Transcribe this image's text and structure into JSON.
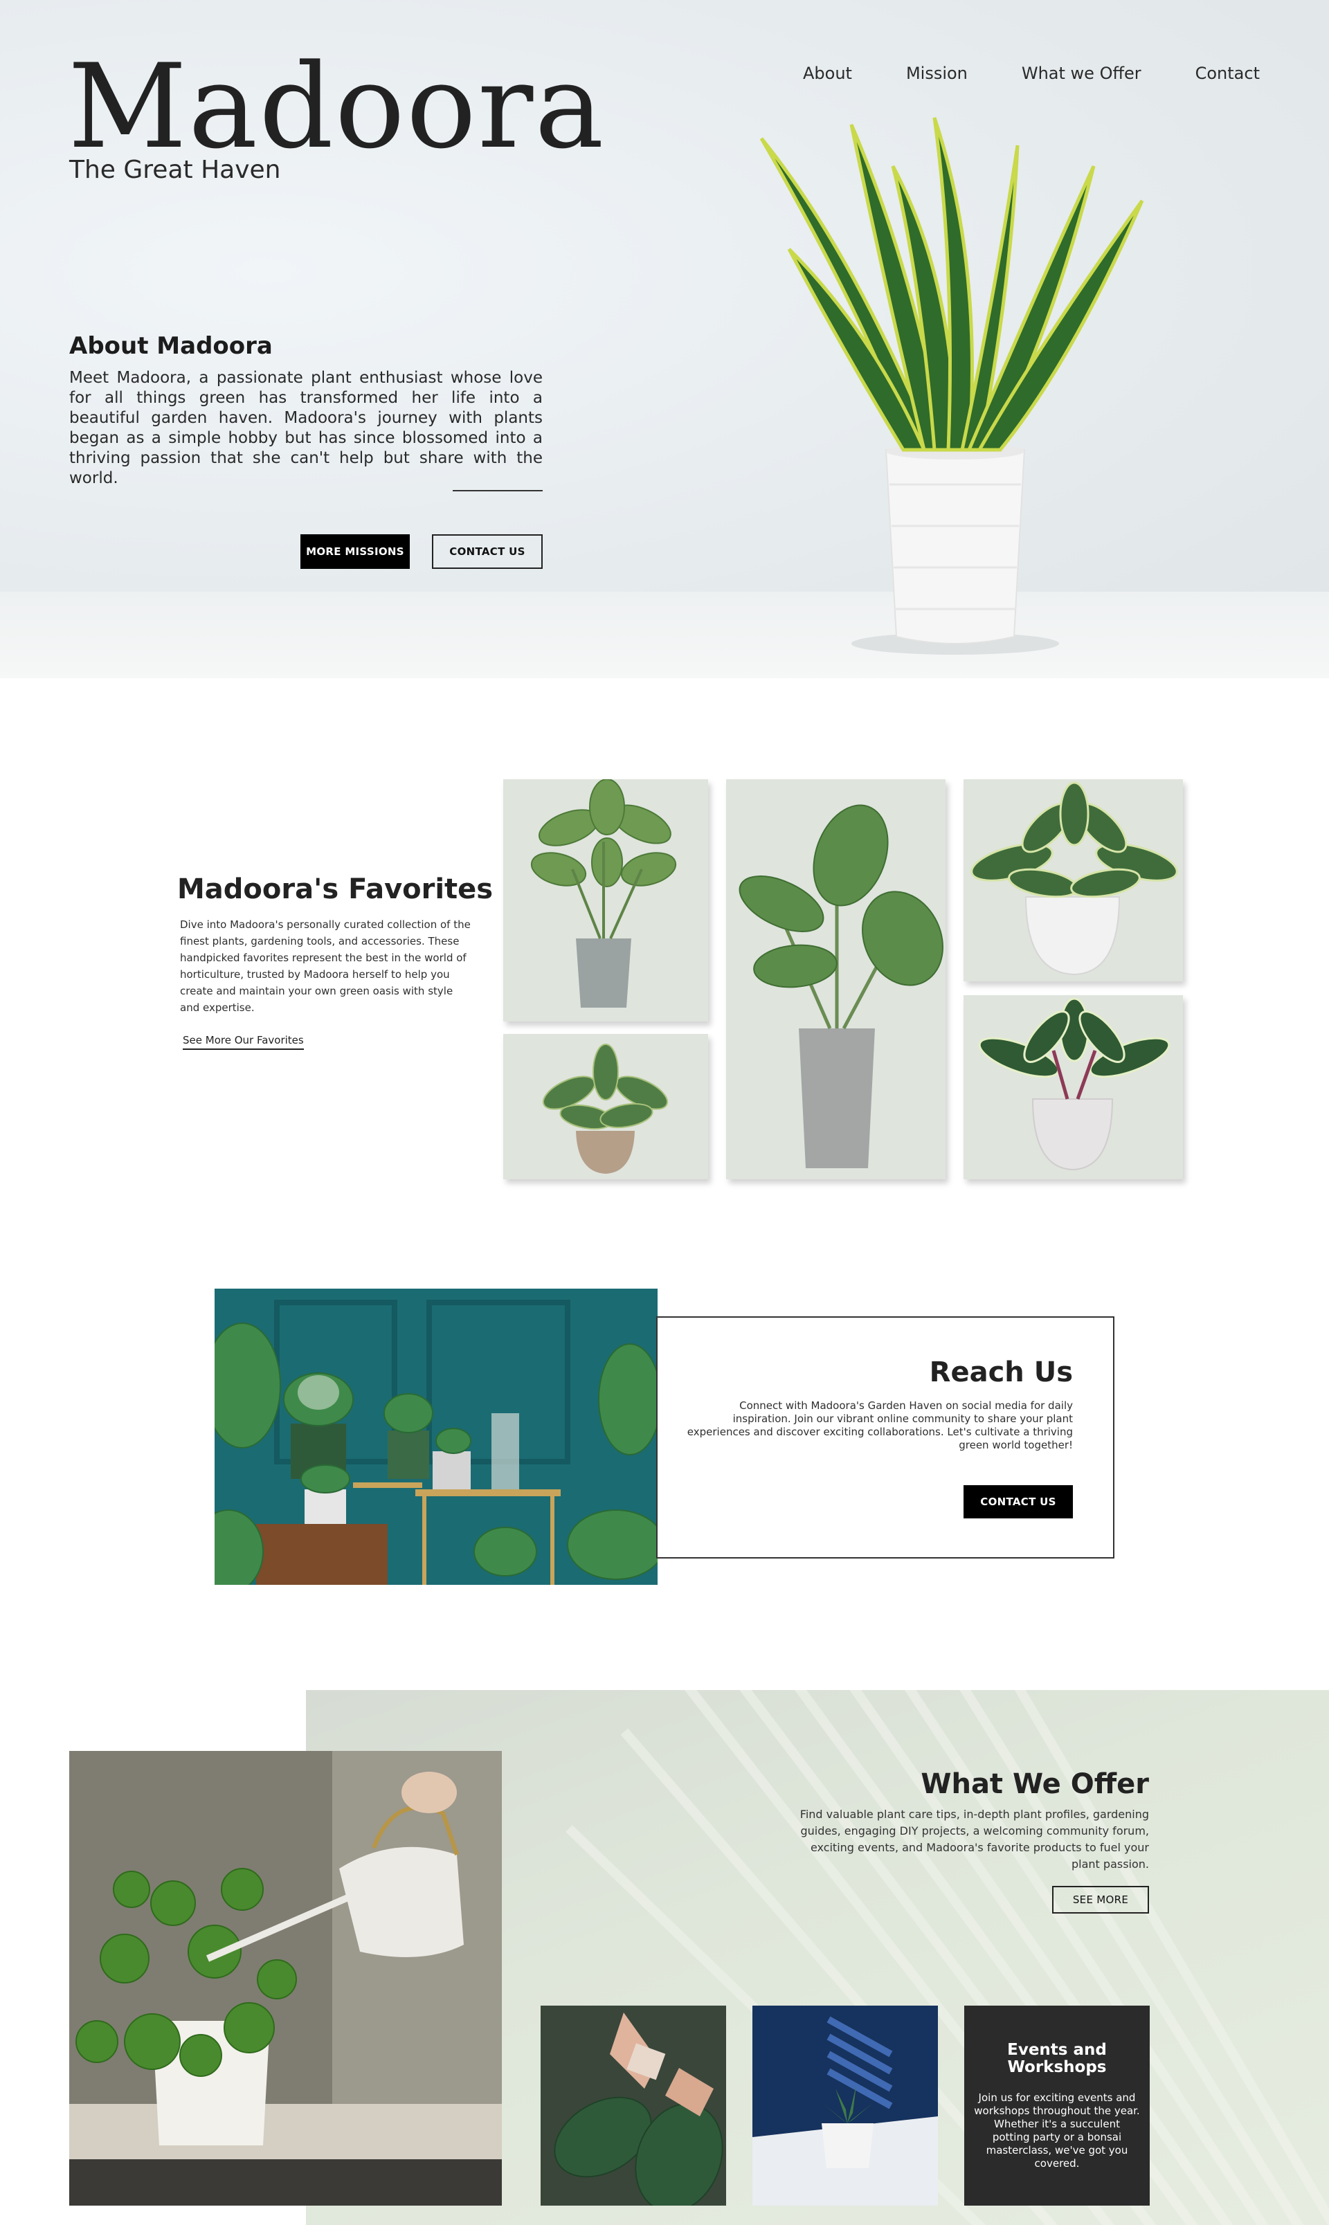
{
  "brand": {
    "name": "Madoora",
    "tagline": "The Great Haven"
  },
  "nav": {
    "items": [
      "About",
      "Mission",
      "What we Offer",
      "Contact"
    ]
  },
  "about": {
    "heading": "About Madoora",
    "body": "Meet Madoora, a passionate plant enthusiast whose love for all things green has transformed her life into a beautiful garden haven. Madoora's journey with plants began as a simple hobby but has since blossomed into a thriving passion that she can't help but share with the world.",
    "primary_button": "MORE MISSIONS",
    "secondary_button": "CONTACT US"
  },
  "favorites": {
    "heading": "Madoora's Favorites",
    "body": "Dive into Madoora's personally curated collection of the finest plants, gardening tools, and accessories. These handpicked favorites represent the best in the world of horticulture, trusted by Madoora herself to help you create and maintain your own green oasis with style and expertise.",
    "link": "See More Our Favorites"
  },
  "reach": {
    "heading": "Reach Us",
    "body": "Connect with Madoora's Garden Haven on social media for daily inspiration. Join our vibrant online community to share your plant experiences and discover exciting collaborations. Let's cultivate a thriving green world together!",
    "button": "CONTACT US"
  },
  "offer": {
    "heading": "What We Offer",
    "body": "Find valuable plant care tips, in-depth plant profiles, gardening guides, engaging DIY projects, a welcoming community forum, exciting events, and Madoora's favorite products to fuel your plant passion.",
    "button": "SEE MORE",
    "events_heading": "Events and Workshops",
    "events_body": "Join us for exciting events and workshops throughout the year. Whether it's a succulent potting party or a bonsai masterclass, we've got you covered."
  },
  "colors": {
    "accent": "#000000",
    "card_bg": "#dfe4dd",
    "offer_bg": "#dfe6da"
  }
}
